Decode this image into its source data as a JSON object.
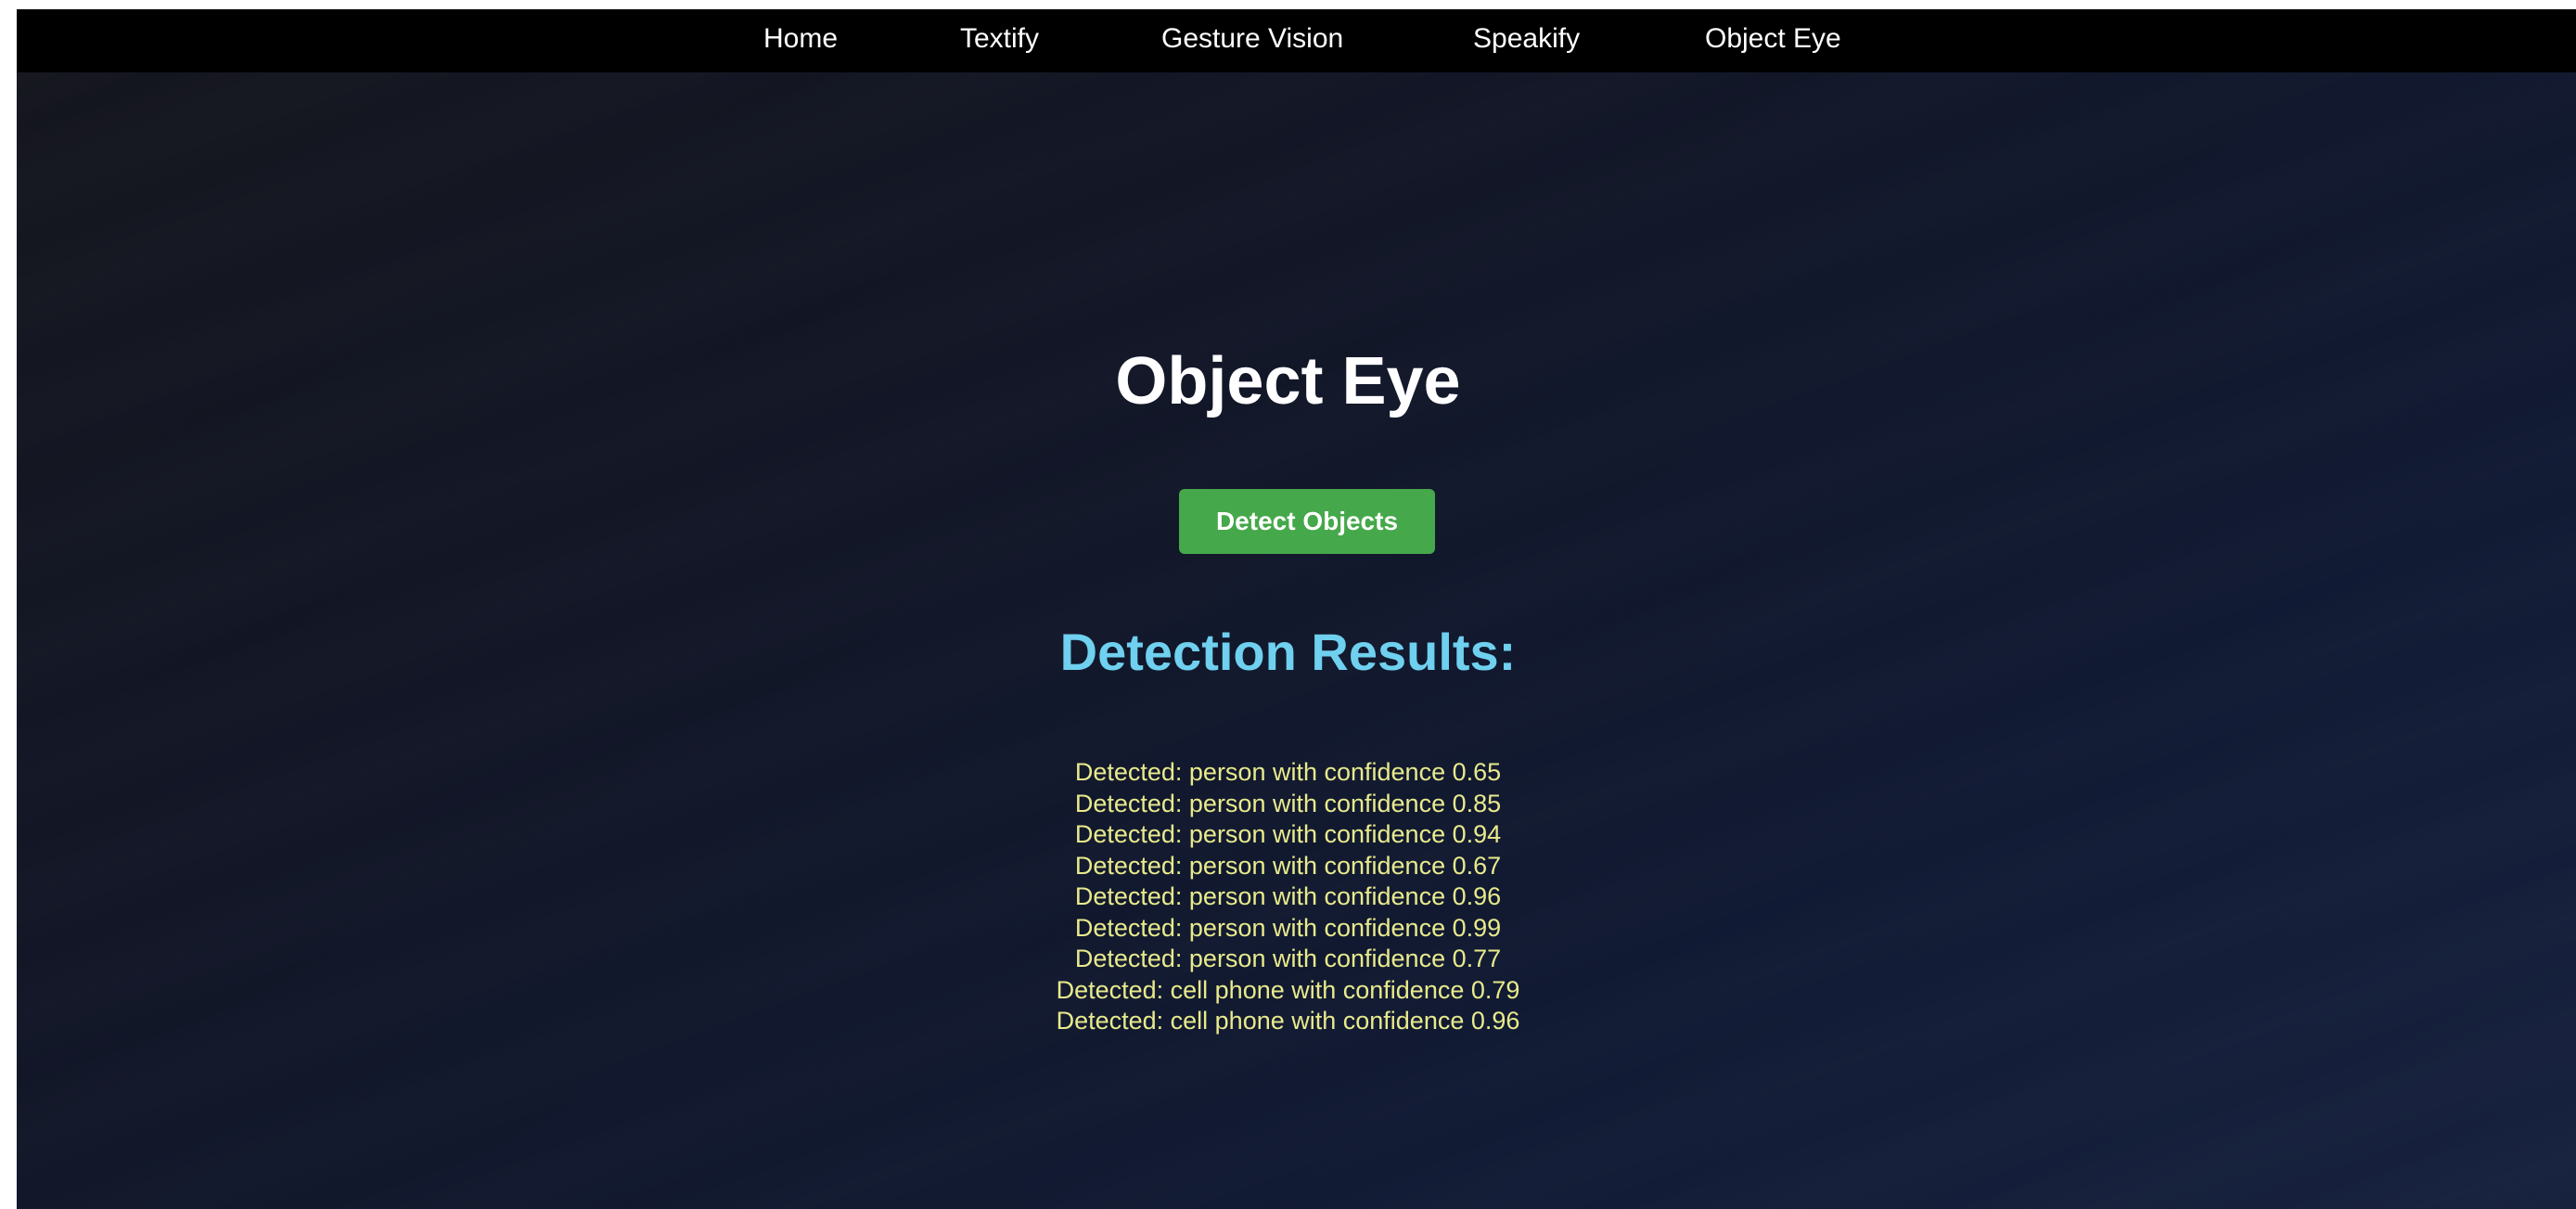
{
  "nav": {
    "items": [
      {
        "label": "Home"
      },
      {
        "label": "Textify"
      },
      {
        "label": "Gesture Vision"
      },
      {
        "label": "Speakify"
      },
      {
        "label": "Object Eye"
      }
    ]
  },
  "main": {
    "title": "Object Eye",
    "detect_button_label": "Detect Objects",
    "results_heading": "Detection Results:",
    "results": [
      "Detected: person with confidence 0.65",
      "Detected: person with confidence 0.85",
      "Detected: person with confidence 0.94",
      "Detected: person with confidence 0.67",
      "Detected: person with confidence 0.96",
      "Detected: person with confidence 0.99",
      "Detected: person with confidence 0.77",
      "Detected: cell phone with confidence 0.79",
      "Detected: cell phone with confidence 0.96"
    ]
  },
  "colors": {
    "nav_background": "#000000",
    "button_accent": "#45a84a",
    "results_heading": "#6fd0ef",
    "result_text": "#e8ea8c"
  }
}
